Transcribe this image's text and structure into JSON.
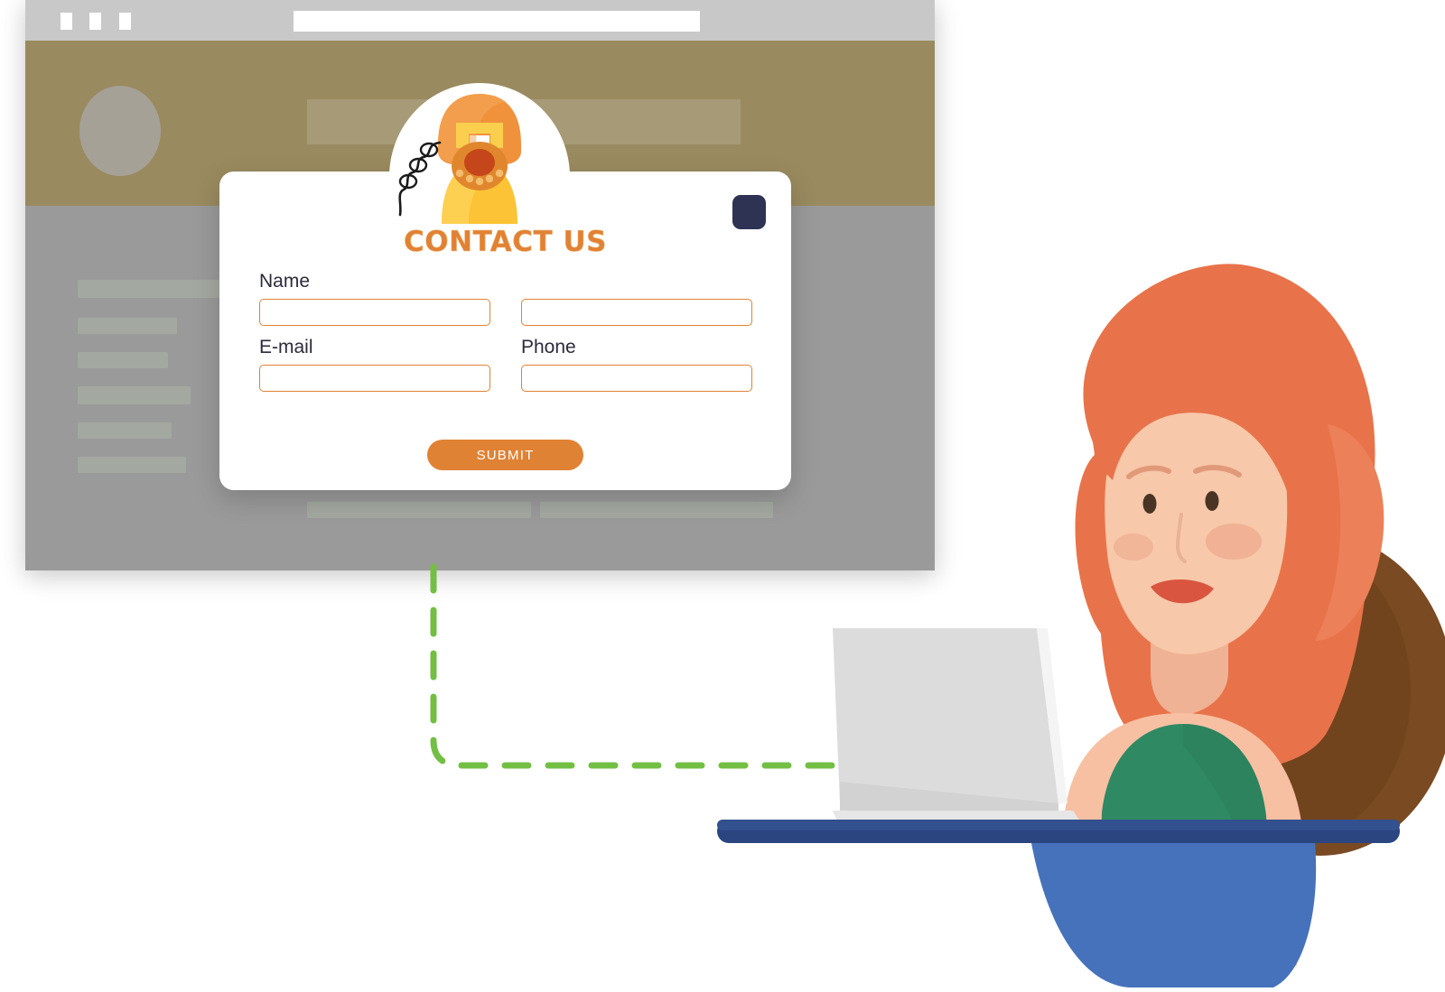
{
  "browser": {
    "window_controls": [
      "minimize-box",
      "maximize-box",
      "close-box"
    ],
    "url_value": "",
    "url_placeholder": ""
  },
  "site": {
    "header_color": "#9a8a5f",
    "body_color": "#9a9a9a",
    "logo_label": "",
    "nav_label": "",
    "sidebar_items": [
      "",
      "",
      "",
      "",
      "",
      ""
    ],
    "footer_items": [
      "",
      ""
    ]
  },
  "form": {
    "icon_name": "rotary-telephone-icon",
    "title": "CONTACT US",
    "badge_color": "#2e3354",
    "accent_color": "#e08234",
    "fields": [
      {
        "label": "Name",
        "value": "",
        "placeholder": ""
      },
      {
        "label": "",
        "value": "",
        "placeholder": ""
      },
      {
        "label": "E-mail",
        "value": "",
        "placeholder": ""
      },
      {
        "label": "Phone",
        "value": "",
        "placeholder": ""
      }
    ],
    "submit_label": "SUBMIT"
  },
  "connector": {
    "color": "#72bf44",
    "style": "dashed"
  },
  "character": {
    "hair_color": "#e8734a",
    "skin_color": "#f7c0a3",
    "top_color": "#2f8a63",
    "skirt_color": "#4672bb",
    "chair_color": "#7a4a22",
    "desk_color": "#2b4580",
    "laptop_color": "#dcdcdc"
  }
}
